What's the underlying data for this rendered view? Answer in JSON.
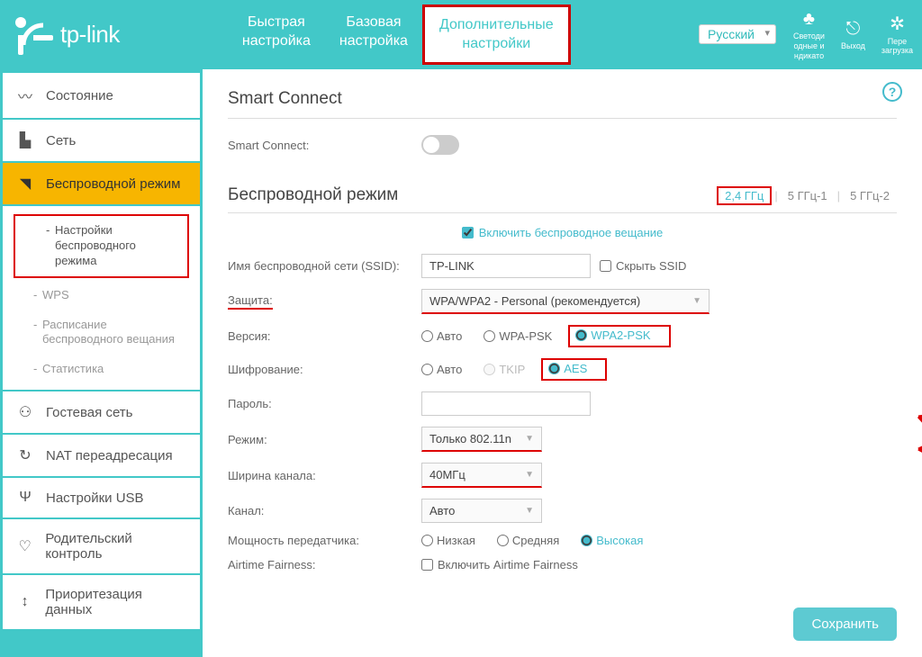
{
  "brand": "tp-link",
  "topnav": {
    "quick": "Быстрая\nнастройка",
    "basic": "Базовая\nнастройка",
    "advanced": "Дополнительные\nнастройки"
  },
  "lang": "Русский",
  "header_icons": {
    "led": "Светоди\nодные и\nндикато",
    "logout": "Выход",
    "reboot": "Пере\nзагрузка"
  },
  "sidebar": {
    "status": "Состояние",
    "network": "Сеть",
    "wireless": "Беспроводной режим",
    "wireless_sub": {
      "settings": "Настройки беспроводного режима",
      "wps": "WPS",
      "schedule": "Расписание беспроводного вещания",
      "stats": "Статистика"
    },
    "guest": "Гостевая сеть",
    "nat": "NAT переадресация",
    "usb": "Настройки USB",
    "parental": "Родительский контроль",
    "qos": "Приоритезация данных"
  },
  "content": {
    "smart_connect_title": "Smart Connect",
    "smart_connect_label": "Smart Connect:",
    "wireless_title": "Беспроводной режим",
    "bands": {
      "b24": "2,4 ГГц",
      "b51": "5 ГГц-1",
      "b52": "5 ГГц-2"
    },
    "enable_radio": "Включить беспроводное вещание",
    "ssid_label": "Имя беспроводной сети (SSID):",
    "ssid_value": "TP-LINK",
    "hide_ssid": "Скрыть SSID",
    "security_label": "Защита:",
    "security_value": "WPA/WPA2 - Personal (рекомендуется)",
    "version_label": "Версия:",
    "version_opts": {
      "auto": "Авто",
      "wpa": "WPA-PSK",
      "wpa2": "WPA2-PSK"
    },
    "encryption_label": "Шифрование:",
    "encryption_opts": {
      "auto": "Авто",
      "tkip": "TKIP",
      "aes": "AES"
    },
    "password_label": "Пароль:",
    "mode_label": "Режим:",
    "mode_value": "Только 802.11n",
    "width_label": "Ширина канала:",
    "width_value": "40МГц",
    "channel_label": "Канал:",
    "channel_value": "Авто",
    "tx_label": "Мощность передатчика:",
    "tx_opts": {
      "low": "Низкая",
      "mid": "Средняя",
      "high": "Высокая"
    },
    "airtime_label": "Airtime Fairness:",
    "airtime_chk": "Включить Airtime Fairness",
    "save": "Сохранить"
  }
}
